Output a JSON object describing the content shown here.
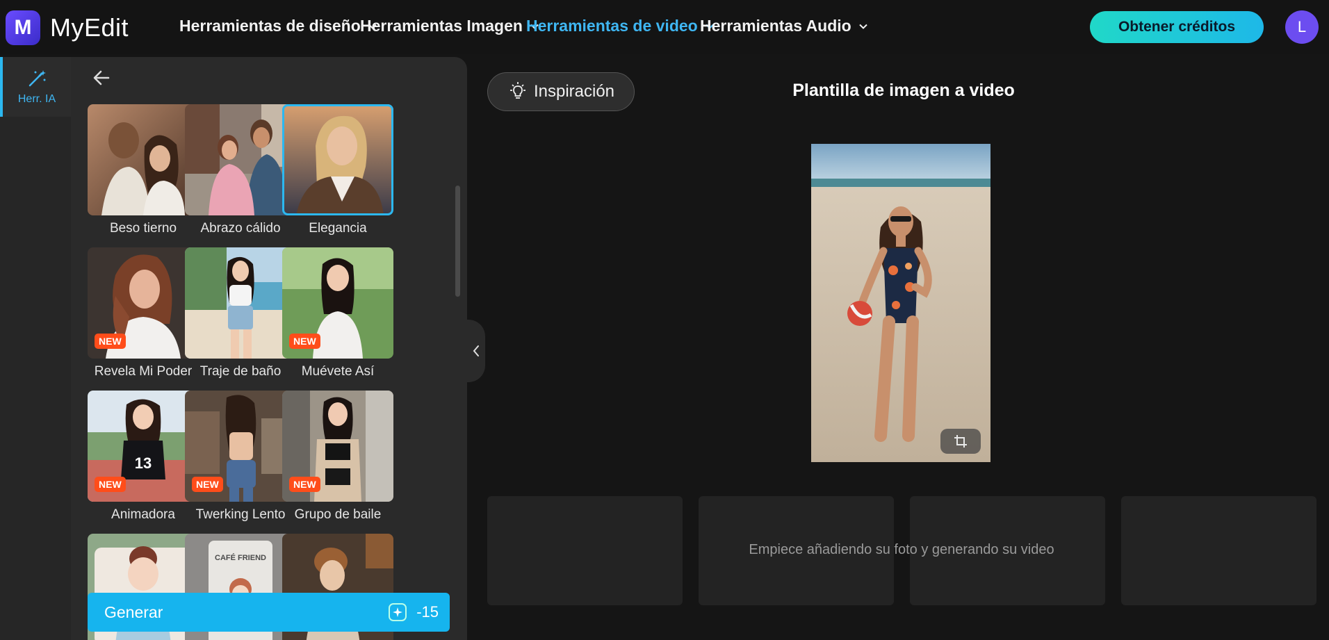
{
  "app": {
    "name": "MyEdit",
    "logo_letter": "M"
  },
  "nav": {
    "items": [
      {
        "label": "Herramientas de diseño",
        "active": false
      },
      {
        "label": "Herramientas Imagen",
        "active": false
      },
      {
        "label": "Herramientas de video",
        "active": true
      },
      {
        "label": "Herramientas Audio",
        "active": false
      }
    ],
    "credits_button": "Obtener créditos",
    "avatar_initial": "L"
  },
  "rail": {
    "items": [
      {
        "label": "Herr. IA",
        "icon": "magic-wand-icon",
        "active": true
      }
    ]
  },
  "templates": {
    "items": [
      {
        "name": "Beso tierno",
        "new": false,
        "selected": false
      },
      {
        "name": "Abrazo cálido",
        "new": false,
        "selected": false
      },
      {
        "name": "Elegancia",
        "new": false,
        "selected": true
      },
      {
        "name": "Revela Mi Poder",
        "new": true,
        "selected": false
      },
      {
        "name": "Traje de baño",
        "new": false,
        "selected": false
      },
      {
        "name": "Muévete Así",
        "new": true,
        "selected": false
      },
      {
        "name": "Animadora",
        "new": true,
        "selected": false
      },
      {
        "name": "Twerking Lento",
        "new": true,
        "selected": false
      },
      {
        "name": "Grupo de baile",
        "new": true,
        "selected": false
      },
      {
        "name": "",
        "new": false,
        "selected": false
      },
      {
        "name": "",
        "new": false,
        "selected": false,
        "thumb_text": "CAFÉ FRIEND"
      },
      {
        "name": "",
        "new": false,
        "selected": false
      }
    ],
    "badge_label": "NEW"
  },
  "generate": {
    "label": "Generar",
    "cost": "-15"
  },
  "main": {
    "inspiration_button": "Inspiración",
    "title": "Plantilla de imagen a video",
    "results_message": "Empiece añadiendo su foto y generando su video"
  },
  "colors": {
    "accent": "#16b4ee",
    "nav_active": "#3fb6f2",
    "badge": "#ff4d1a",
    "avatar": "#6c4df0"
  }
}
